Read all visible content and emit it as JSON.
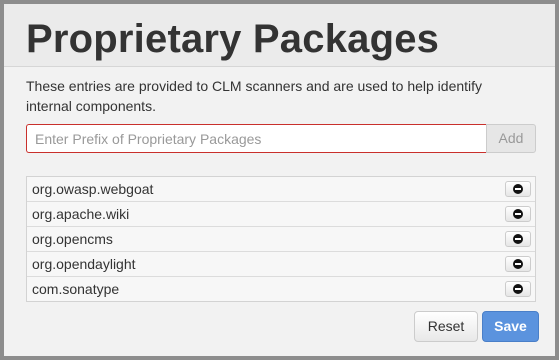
{
  "dialog": {
    "title": "Proprietary Packages",
    "description": "These entries are provided to CLM scanners and are used to help identify internal components."
  },
  "prefix_input": {
    "value": "",
    "placeholder": "Enter Prefix of Proprietary Packages"
  },
  "add_button": {
    "label": "Add"
  },
  "packages": [
    {
      "name": "org.owasp.webgoat",
      "remove_icon": "minus-circle-icon"
    },
    {
      "name": "org.apache.wiki",
      "remove_icon": "minus-circle-icon"
    },
    {
      "name": "org.opencms",
      "remove_icon": "minus-circle-icon"
    },
    {
      "name": "org.opendaylight",
      "remove_icon": "minus-circle-icon"
    },
    {
      "name": "com.sonatype",
      "remove_icon": "minus-circle-icon"
    }
  ],
  "footer": {
    "reset_label": "Reset",
    "save_label": "Save"
  },
  "colors": {
    "input_error_border": "#c9302c",
    "save_button": "#5b93de"
  }
}
